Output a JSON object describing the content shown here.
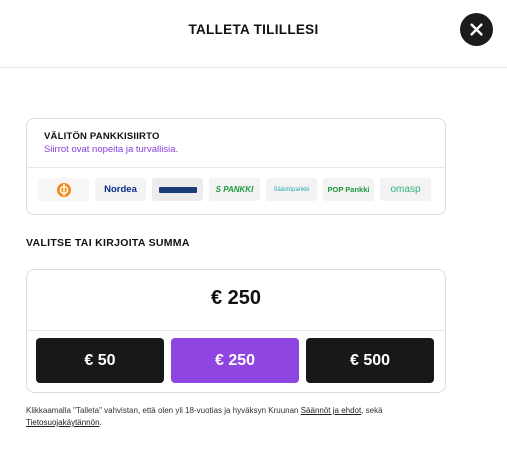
{
  "header": {
    "title": "TALLETA TILILLESI",
    "close_icon": "close-icon"
  },
  "bank_transfer": {
    "title": "VÄLITÖN PANKKISIIRTO",
    "subtitle": "Siirrot ovat nopeita ja turvallisia.",
    "banks": [
      {
        "name": "op-logo",
        "text": ""
      },
      {
        "name": "nordea-logo",
        "text": "Nordea"
      },
      {
        "name": "danske-logo",
        "text": ""
      },
      {
        "name": "s-pankki-logo",
        "text": "S PANKKI"
      },
      {
        "name": "saastopankki-logo",
        "text": "Säästöpankki"
      },
      {
        "name": "pop-pankki-logo",
        "text": "POP Pankki"
      },
      {
        "name": "omasp-logo",
        "text": "omasp"
      }
    ]
  },
  "amount": {
    "heading": "VALITSE TAI KIRJOITA SUMMA",
    "value": "€ 250",
    "presets": [
      "€ 50",
      "€ 250",
      "€ 500"
    ],
    "selected_index": 1
  },
  "terms": {
    "text_before": "Klikkaamalla \"Talleta\" vahvistan, että olen yli 18-vuotias ja hyväksyn Kruunan ",
    "rules_link": "Säännöt ja ehdot",
    "text_middle": ", sekä ",
    "privacy_link": "Tietosuojakäytännön",
    "text_after": "."
  },
  "colors": {
    "accent": "#8e45e2",
    "dark_button": "#181818",
    "subtitle": "#8a3fdc"
  }
}
